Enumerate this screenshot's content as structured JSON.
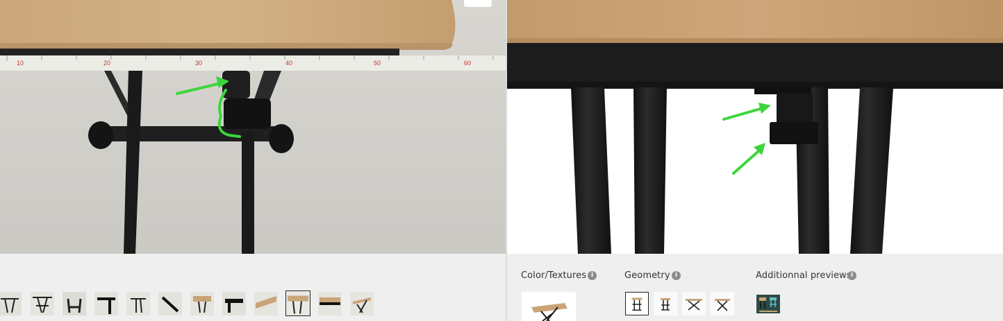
{
  "left_viewer": {
    "photo": "photo of folding table underside with tape measure, green annotation arrow",
    "tape_numbers": [
      "10",
      "20",
      "30",
      "40",
      "50",
      "60"
    ],
    "thumbnails": [
      {
        "name": "thumb-1",
        "active": false
      },
      {
        "name": "thumb-2",
        "active": false
      },
      {
        "name": "thumb-3",
        "active": false
      },
      {
        "name": "thumb-4",
        "active": false
      },
      {
        "name": "thumb-5",
        "active": false
      },
      {
        "name": "thumb-6",
        "active": false
      },
      {
        "name": "thumb-7",
        "active": false
      },
      {
        "name": "thumb-8",
        "active": false
      },
      {
        "name": "thumb-9",
        "active": false
      },
      {
        "name": "thumb-10",
        "active": true
      },
      {
        "name": "thumb-11",
        "active": false
      },
      {
        "name": "thumb-12",
        "active": false
      }
    ]
  },
  "right_viewer": {
    "render": "3D render of table underside with lever, two green arrows"
  },
  "panels": {
    "color_textures": {
      "label": "Color/Textures",
      "info": "i"
    },
    "geometry": {
      "label": "Geometry",
      "info": "i",
      "selected_index": 0
    },
    "additional_previews": {
      "label": "Additionnal previews",
      "info": "i"
    }
  },
  "colors": {
    "wood": "#c8a477",
    "leg": "#1c1c1c",
    "arrow": "#3bd63b",
    "background": "#efefef"
  }
}
